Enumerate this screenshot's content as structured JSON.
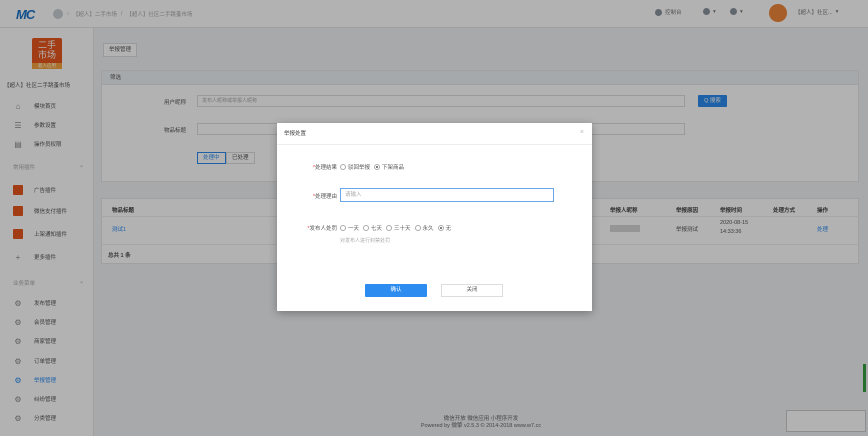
{
  "topbar": {
    "logo": "MC",
    "breadcrumb": [
      "【超人】二手市场",
      "/",
      "【超人】社区二手跳蚤市场"
    ],
    "nav_console": "控制台",
    "nav_user": "【超人】社区...",
    "colors": {
      "accent": "#2d8cf0",
      "brand": "#e8561d"
    }
  },
  "sidebar": {
    "shop_logo_line1": "二手",
    "shop_logo_line2": "市场",
    "shop_logo_sub": "超人应用",
    "shop_name": "【超人】社区二手跳蚤市场",
    "top_items": [
      {
        "label": "模块首页",
        "icon": "home-icon"
      },
      {
        "label": "参数设置",
        "icon": "settings-list-icon"
      },
      {
        "label": "操作员权限",
        "icon": "document-icon"
      }
    ],
    "group1": "常用插件",
    "plugins": [
      {
        "label": "广告插件"
      },
      {
        "label": "微信支付插件"
      },
      {
        "label": "上架通知插件"
      },
      {
        "label": "更多插件",
        "icon": "plus-icon"
      }
    ],
    "group2": "业务菜单",
    "business": [
      {
        "label": "发布管理"
      },
      {
        "label": "会员管理"
      },
      {
        "label": "商家管理"
      },
      {
        "label": "订单管理"
      },
      {
        "label": "举报管理",
        "active": true
      },
      {
        "label": "纠纷管理"
      },
      {
        "label": "分类管理"
      }
    ]
  },
  "main": {
    "tab": "举报管理",
    "filter": {
      "header": "筛选",
      "label_user": "用户昵称",
      "placeholder_user": "发布人昵称或举报人昵称",
      "label_item": "物品标题",
      "search_btn": "Q 搜索",
      "seg_pending": "处理中",
      "seg_done": "已处理"
    },
    "table": {
      "headers": [
        "物品标题",
        "举报人昵称",
        "举报原因",
        "举报时间",
        "处理方式",
        "操作"
      ],
      "rows": [
        {
          "title": "测试1",
          "reason": "举报测试",
          "time_date": "2020-08-15",
          "time_clock": "14:33:36",
          "method": "",
          "action": "处理"
        }
      ],
      "total": "总共 1 条"
    }
  },
  "modal": {
    "title": "举报处置",
    "result_label": "处理结果",
    "result_options": [
      {
        "label": "驳回举报",
        "checked": false
      },
      {
        "label": "下架商品",
        "checked": true
      }
    ],
    "reason_label": "处理理由",
    "reason_placeholder": "请输入",
    "ban_label": "发布人处罚",
    "ban_options": [
      {
        "label": "一天",
        "checked": false
      },
      {
        "label": "七天",
        "checked": false
      },
      {
        "label": "三十天",
        "checked": false
      },
      {
        "label": "永久",
        "checked": false
      },
      {
        "label": "无",
        "checked": true
      }
    ],
    "ban_hint": "对发布人进行封禁处罚",
    "confirm": "确认",
    "close": "关闭"
  },
  "footer": {
    "links": "微信开放    微信应用    小程序开发",
    "copyright": "Powered by 微擎 v2.5.3 © 2014-2018 www.w7.cc"
  }
}
